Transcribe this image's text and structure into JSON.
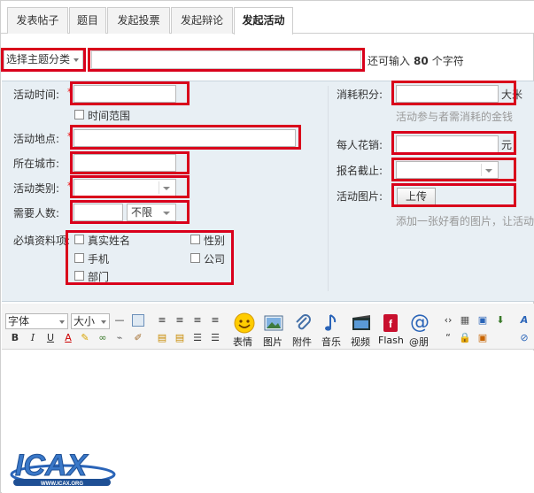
{
  "tabs": [
    {
      "label": "发表帖子",
      "active": false
    },
    {
      "label": "题目",
      "active": false
    },
    {
      "label": "发起投票",
      "active": false
    },
    {
      "label": "发起辩论",
      "active": false
    },
    {
      "label": "发起活动",
      "active": true
    }
  ],
  "subject": {
    "category_label": "选择主题分类",
    "value": "",
    "remaining_prefix": "还可输入",
    "remaining_count": "80",
    "remaining_suffix": "个字符"
  },
  "form": {
    "time_label": "活动时间:",
    "time_range_label": "时间范围",
    "place_label": "活动地点:",
    "city_label": "所在城市:",
    "type_label": "活动类别:",
    "people_label": "需要人数:",
    "people_limit": "不限",
    "required_label": "必填资料项:",
    "required_fields": [
      "真实姓名",
      "性别",
      "手机",
      "公司",
      "部门"
    ],
    "credit_label": "消耗积分:",
    "credit_unit": "大米",
    "credit_hint": "活动参与者需消耗的金钱",
    "cost_label": "每人花销:",
    "cost_unit": "元",
    "deadline_label": "报名截止:",
    "image_label": "活动图片:",
    "upload_label": "上传",
    "image_hint": "添加一张好看的图片，让活动"
  },
  "toolbar": {
    "font_label": "字体",
    "size_label": "大小",
    "big_tools": [
      "表情",
      "图片",
      "附件",
      "音乐",
      "视频",
      "Flash",
      "@朋"
    ]
  },
  "logo": {
    "text": "ICAX",
    "sub": "WWW.ICAX.ORG"
  },
  "colors": {
    "highlight": "#d9001b",
    "panel": "#e8eff4",
    "required": "#e00000"
  }
}
